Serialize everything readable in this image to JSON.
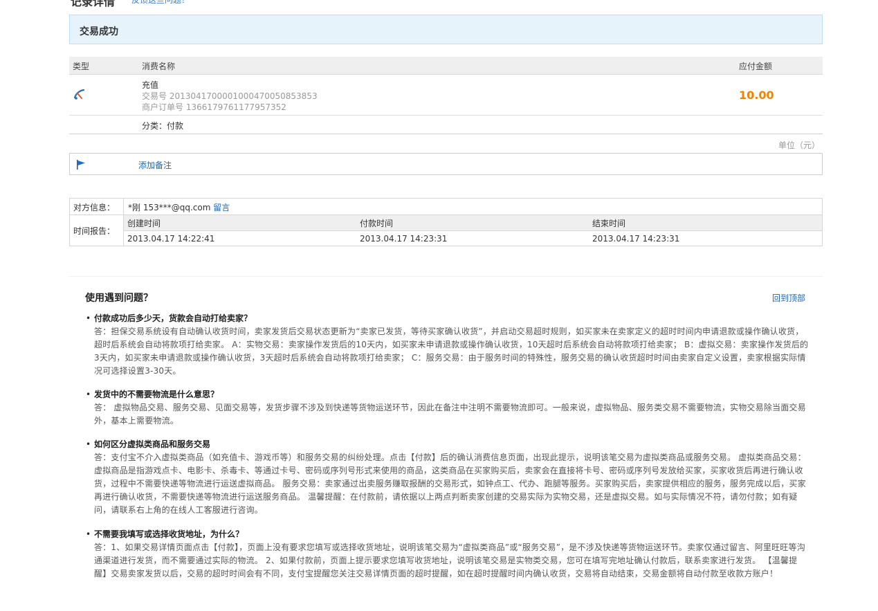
{
  "header": {
    "title": "记录详情",
    "link": "反馈这些问题？"
  },
  "status": {
    "text": "交易成功"
  },
  "table": {
    "columns": [
      "类型",
      "消费名称",
      "应付金额"
    ],
    "item": {
      "type_icon": "alipay-recharge-icon",
      "name": "充值",
      "trade_no": "交易号 20130417000010004700508538​53",
      "merchant_no": "商户订单号 1366179761177957352",
      "amount": "10.00",
      "category": "分类：付款"
    },
    "unit": "单位（元）"
  },
  "note": {
    "icon": "flag-icon",
    "label": "添加备注"
  },
  "info": {
    "counterparty_label": "对方信息：",
    "counterparty_value": "*刚 153***@qq.com",
    "message_link": "留言",
    "time_label": "时间报告：",
    "time_columns": [
      "创建时间",
      "付款时间",
      "结束时间"
    ],
    "time_values": [
      "2013.04.17 14:22:41",
      "2013.04.17 14:23:31",
      "2013.04.17 14:23:31"
    ]
  },
  "faq": {
    "title": "使用遇到问题？",
    "back_to_top": "回到顶部",
    "items": [
      {
        "q": "付款成功后多少天，货款会自动打给卖家？",
        "a": "答：担保交易系统设有自动确认收货时间，卖家发货后交易状态更新为“卖家已发货，等待买家确认收货”，并启动交易超时规则，如买家未在卖家定义的超时时间内申请退款或操作确认收货，超时后系统会自动将款项打给卖家。 A：实物交易：卖家操作发货后的10天内，如买家未申请退款或操作确认收货，10天超时后系统会自动将款项打给卖家； B：虚拟交易：卖家操作发货后的3天内，如买家未申请退款或操作确认收货，3天超时后系统会自动将款项打给卖家； C：服务交易：由于服务时间的特殊性，服务交易的确认收货超时时间由卖家自定义设置，卖家根据实际情况可选择设置3-30天。"
      },
      {
        "q": "发货中的不需要物流是什么意思？",
        "a": "答： 虚拟物品交易、服务交易、见面交易等，发货步骤不涉及到快递等货物运送环节，因此在备注中注明不需要物流即可。一般来说，虚拟物品、服务类交易不需要物流，实物交易除当面交易外，基本上需要物流。"
      },
      {
        "q": "如何区分虚拟类商品和服务交易",
        "a": "答：支付宝不介入虚拟类商品（如充值卡、游戏币等）和服务交易的纠纷处理。点击【付款】后的确认消费信息页面，出现此提示，说明该笔交易为虚拟类商品或服务交易。 虚拟类商品交易：虚拟商品是指游戏点卡、电影卡、杀毒卡、等通过卡号、密码或序列号形式来使用的商品，这类商品在买家购买后，卖家会在直接将卡号、密码或序列号发放给买家，买家收货后再进行确认收货，过程中不需要快递等物流进行运送虚拟商品。 服务交易：卖家通过出卖服务赚取报酬的交易形式，如钟点工、代办、跑腿等服务。买家购买后，卖家提供相应的服务，服务完成以后，买家再进行确认收货，不需要快递等物流进行运送服务商品。 温馨提醒：在付款前，请依据以上两点判断卖家创建的交易实际为实物交易，还是虚拟交易。如与实际情况不符，请勿付款；如有疑问，请联系右上角的在线人工客服进行咨询。"
      },
      {
        "q": "不需要我填写或选择收货地址，为什么？",
        "a": "答：1、如果交易详情页面点击【付款】，页面上没有要求您填写或选择收货地址，说明该笔交易为“虚拟类商品”或“服务交易”，是不涉及快递等货物运送环节。卖家仅通过留言、阿里旺旺等沟通渠道进行发货，而不需要通过实际的物流。 2、如果付款前，页面上提示要求您填写收货地址，说明该笔交易是实物类交易，您可在填写完地址确认付款后，联系卖家进行发货。 【温馨提醒】交易卖家发货以后，交易的超时时间会有不同，支付宝提醒您关注交易详情页面的超时提醒，如在超时提醒时间内确认收货，交易将自动结束，交易金额将自动付款至收款方账户！"
      }
    ]
  }
}
